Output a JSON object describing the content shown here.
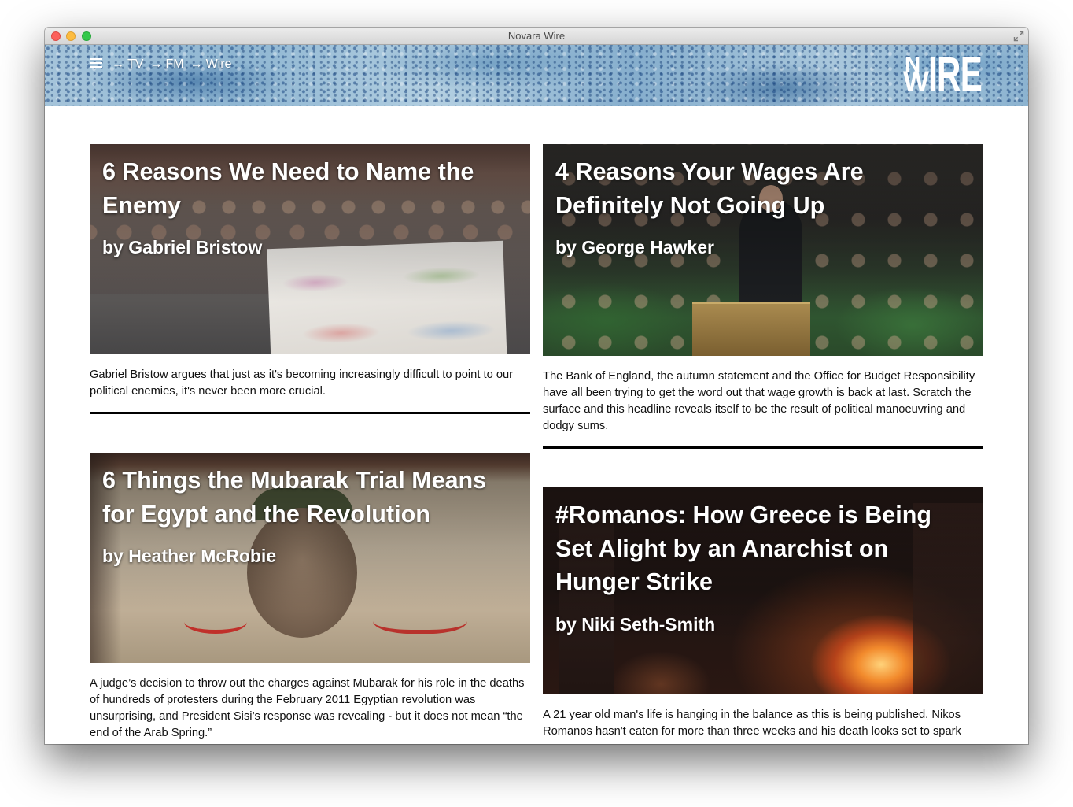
{
  "window": {
    "title": "Novara Wire"
  },
  "icons": {
    "window_controls": [
      "close-icon",
      "minimize-icon",
      "zoom-icon"
    ],
    "fullscreen": "fullscreen-icon",
    "menu": "hamburger-icon"
  },
  "header": {
    "nav": [
      {
        "arrow": "→",
        "label": "TV"
      },
      {
        "arrow": "→",
        "label": "FM"
      },
      {
        "arrow": "→",
        "label": "Wire"
      }
    ],
    "logo": {
      "mark_top": "N",
      "mark_bottom": "W",
      "text": "IRE"
    }
  },
  "colors": {
    "title_text": "#ffffff",
    "body_text": "#111111",
    "divider": "#000000",
    "header_blue": "#8fb6d2"
  },
  "articles": [
    {
      "title": "6 Reasons We Need to Name the Enemy",
      "byline": "by Gabriel Bristow",
      "summary": "Gabriel Bristow argues that just as it's becoming increasingly difficult to point to our political enemies, it's never been more crucial."
    },
    {
      "title": "4 Reasons Your Wages Are Definitely Not Going Up",
      "byline": "by George Hawker",
      "summary": "The Bank of England, the autumn statement and the Office for Budget Responsibility have all been trying to get the word out that wage growth is back at last. Scratch the surface and this headline reveals itself to be the result of political manoeuvring and dodgy sums."
    },
    {
      "title": "6 Things the Mubarak Trial Means for Egypt and the Revolution",
      "byline": "by Heather McRobie",
      "summary": "A judge’s decision to throw out the charges against Mubarak for his role in the deaths of hundreds of protesters during the February 2011 Egyptian revolution was unsurprising, and President Sisi’s response was revealing - but it does not mean “the end of the Arab Spring.”"
    },
    {
      "title": "#Romanos: How Greece is Being Set Alight by an Anarchist on Hunger Strike",
      "byline": "by Niki Seth-Smith",
      "summary": "A 21 year old man's life is hanging in the balance as this is being published. Nikos Romanos hasn't eaten for more than three weeks and his death looks set to spark"
    }
  ]
}
